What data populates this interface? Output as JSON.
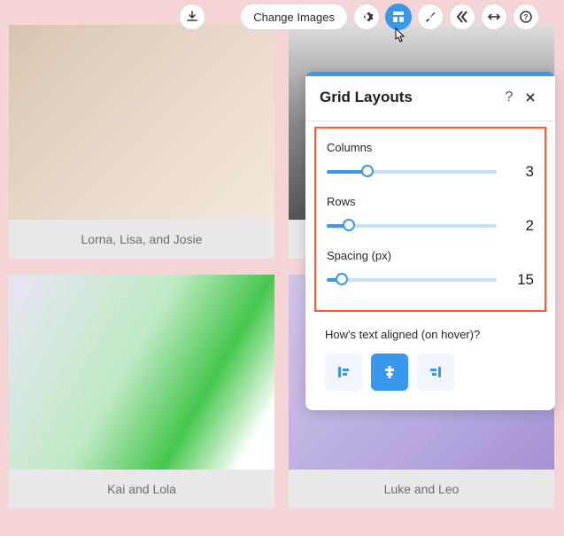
{
  "toolbar": {
    "change_images_label": "Change Images"
  },
  "grid": {
    "cells": [
      {
        "caption": "Lorna, Lisa, and Josie"
      },
      {
        "caption": ""
      },
      {
        "caption": "Kai and Lola"
      },
      {
        "caption": "Luke and Leo"
      }
    ]
  },
  "panel": {
    "title": "Grid Layouts",
    "help_symbol": "?",
    "controls": {
      "columns": {
        "label": "Columns",
        "value": 3,
        "fill_pct": 24
      },
      "rows": {
        "label": "Rows",
        "value": 2,
        "fill_pct": 13
      },
      "spacing": {
        "label": "Spacing (px)",
        "value": 15,
        "fill_pct": 9
      }
    },
    "hover_label": "How's text aligned (on hover)?",
    "alignment_selected": "center"
  }
}
